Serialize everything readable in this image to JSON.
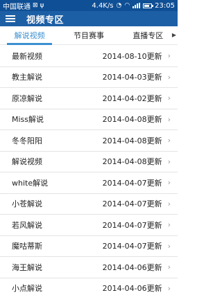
{
  "status_bar": {
    "carrier": "中国联通",
    "speed": "4.4K/s",
    "time": "23:05"
  },
  "app_bar": {
    "title": "视频专区"
  },
  "tabs": [
    {
      "label": "解说视频",
      "active": true
    },
    {
      "label": "节目赛事",
      "active": false
    },
    {
      "label": "直播专区",
      "active": false
    }
  ],
  "list": [
    {
      "name": "最新视频",
      "date": "2014-08-10更新"
    },
    {
      "name": "教主解说",
      "date": "2014-04-03更新"
    },
    {
      "name": "原凉解说",
      "date": "2014-04-02更新"
    },
    {
      "name": "Miss解说",
      "date": "2014-04-08更新"
    },
    {
      "name": "冬冬阳阳",
      "date": "2014-04-08更新"
    },
    {
      "name": "解说视频",
      "date": "2014-04-08更新"
    },
    {
      "name": "white解说",
      "date": "2014-04-07更新"
    },
    {
      "name": "小苍解说",
      "date": "2014-04-07更新"
    },
    {
      "name": "若风解说",
      "date": "2014-04-07更新"
    },
    {
      "name": "魔咕蒂斯",
      "date": "2014-04-07更新"
    },
    {
      "name": "海王解说",
      "date": "2014-04-06更新"
    },
    {
      "name": "小点解说",
      "date": "2014-04-06更新"
    }
  ],
  "icons": {
    "menu": "hamburger-icon",
    "chevron": "chevron-right-icon",
    "tab_more": "triangle-right-icon"
  },
  "colors": {
    "status_bar": "#0f4f95",
    "app_bar": "#1d5fa5",
    "tab_active": "#3a8fd0"
  }
}
